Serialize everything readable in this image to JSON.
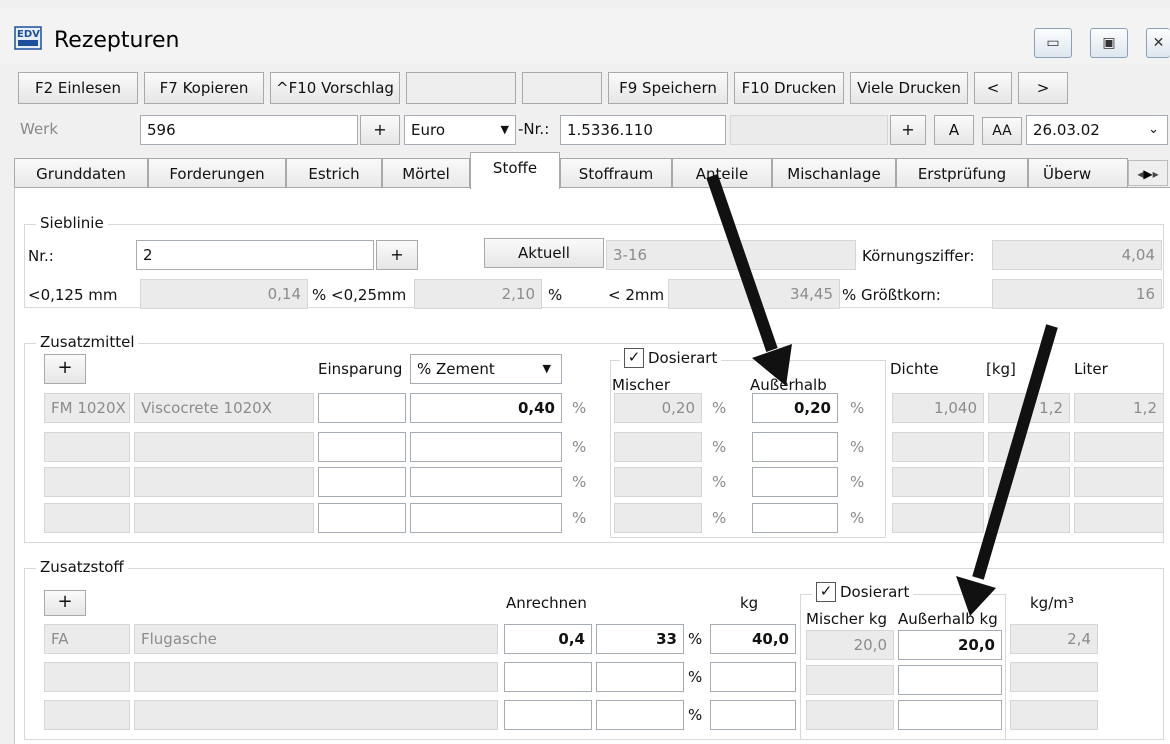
{
  "window": {
    "title": "Rezepturen",
    "icon_text": "EDV",
    "minimize": "▭",
    "maximize": "▣",
    "close": "✕"
  },
  "toolbar": {
    "einlesen": "F2 Einlesen",
    "kopieren": "F7 Kopieren",
    "vorschlag": "^F10 Vorschlag",
    "speichern": "F9 Speichern",
    "drucken": "F10 Drucken",
    "viele_drucken": "Viele Drucken",
    "prev": "<",
    "next": ">"
  },
  "header": {
    "werk_label": "Werk",
    "werk_value": "596",
    "plus": "+",
    "currency": "Euro",
    "nr_label": "-Nr.:",
    "nr_value": "1.5336.110",
    "a_label": "A",
    "aa_label": "AA",
    "date": "26.03.02"
  },
  "tabs": [
    "Grunddaten",
    "Forderungen",
    "Estrich",
    "Mörtel",
    "Stoffe",
    "Stoffraum",
    "Anteile",
    "Mischanlage",
    "Erstprüfung",
    "Überw"
  ],
  "active_tab": "Stoffe",
  "sieblinie": {
    "title": "Sieblinie",
    "nr_label": "Nr.:",
    "nr_value": "2",
    "aktuell": "Aktuell",
    "range": "3-16",
    "koernung_label": "Körnungsziffer:",
    "koernung_value": "4,04",
    "lt0125_label": "<0,125 mm",
    "lt0125_value": "0,14",
    "pct_lt025_label": "% <0,25mm",
    "lt025_value": "2,10",
    "pct": "%",
    "lt2_label": "< 2mm",
    "lt2_value": "34,45",
    "groesst_label": "% Größtkorn:",
    "groesst_value": "16"
  },
  "zusatzmittel": {
    "title": "Zusatzmittel",
    "einsparung_label": "Einsparung",
    "einsparung_select": "% Zement",
    "dosierart_label": "Dosierart",
    "mischer_label": "Mischer",
    "ausserhalb_label": "Außerhalb",
    "dichte_label": "Dichte",
    "kg_label": "[kg]",
    "liter_label": "Liter",
    "pct": "%",
    "row1": {
      "code": "FM 1020X",
      "name": "Viscocrete 1020X",
      "einsparung_value": "0,40",
      "mischer_value": "0,20",
      "ausserhalb_value": "0,20",
      "dichte": "1,040",
      "kg": "1,2",
      "liter": "1,2"
    }
  },
  "zusatzstoff": {
    "title": "Zusatzstoff",
    "anrechnen_label": "Anrechnen",
    "kg_label": "kg",
    "dosierart_label": "Dosierart",
    "mischer_kg_label": "Mischer kg",
    "ausserhalb_kg_label": "Außerhalb kg",
    "kgm3_label": "kg/m³",
    "pct": "%",
    "row1": {
      "code": "FA",
      "name": "Flugasche",
      "anrechnen_value": "0,4",
      "pct_value": "33",
      "kg_value": "40,0",
      "mischer_value": "20,0",
      "ausserhalb_value": "20,0",
      "kgm3_value": "2,4"
    }
  }
}
